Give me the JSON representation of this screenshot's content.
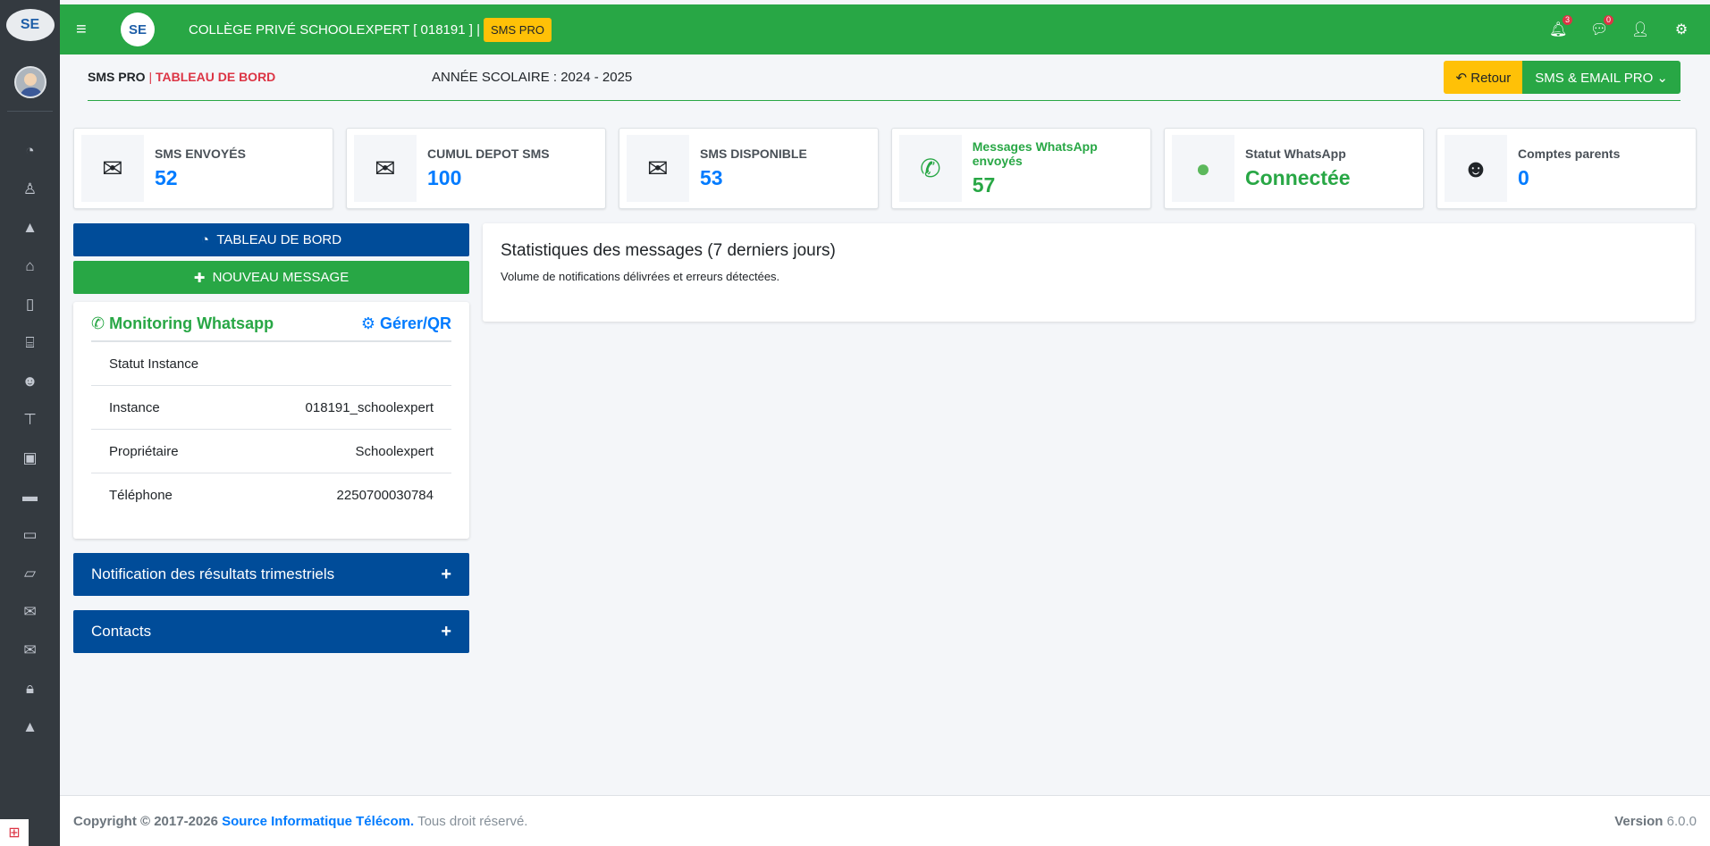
{
  "sidebar": {
    "logo_text": "SE",
    "icons": [
      "dashboard-icon",
      "child-icon",
      "graduation-icon",
      "home-icon",
      "building-icon",
      "bank-icon",
      "users-icon",
      "sitemap-icon",
      "money-icon",
      "folder-icon",
      "bus-icon",
      "folder-open-icon",
      "envelope-icon",
      "envelope-icon",
      "lock-icon",
      "graduation-icon"
    ]
  },
  "topbar": {
    "logo_text": "SE",
    "title": "COLLÈGE PRIVÉ SCHOOLEXPERT [ 018191 ] |",
    "badge": "SMS PRO",
    "notif_count": "3",
    "msg_count": "0"
  },
  "header": {
    "crumb_main": "SMS PRO",
    "crumb_sep": "|",
    "crumb_page": "TABLEAU DE BORD",
    "year": "ANNÉE SCOLAIRE : 2024 - 2025",
    "retour_label": "Retour",
    "sms_email_label": "SMS & EMAIL PRO"
  },
  "cards": [
    {
      "icon": "envelope-outline-icon",
      "label": "SMS ENVOYÉS",
      "value": "52"
    },
    {
      "icon": "envelope-outline-icon",
      "label": "CUMUL DEPOT SMS",
      "value": "100"
    },
    {
      "icon": "envelope-icon",
      "label": "SMS DISPONIBLE",
      "value": "53"
    },
    {
      "icon": "whatsapp-icon",
      "label": "Messages WhatsApp envoyés",
      "value": "57"
    },
    {
      "icon": "green-dot-icon",
      "label": "Statut WhatsApp",
      "value": "Connectée"
    },
    {
      "icon": "users-icon",
      "label": "Comptes parents",
      "value": "0"
    }
  ],
  "left": {
    "dashboard_btn": "TABLEAU DE BORD",
    "new_msg_btn": "NOUVEAU MESSAGE",
    "monitoring_title": "Monitoring Whatsapp",
    "manage_link": "Gérer/QR",
    "rows": [
      {
        "label": "Statut Instance",
        "value": ""
      },
      {
        "label": "Instance",
        "value": "018191_schoolexpert"
      },
      {
        "label": "Propriétaire",
        "value": "Schoolexpert"
      },
      {
        "label": "Téléphone",
        "value": "2250700030784"
      }
    ],
    "notif_panel": "Notification des résultats trimestriels",
    "contacts_panel": "Contacts",
    "plus": "+"
  },
  "stats": {
    "title": "Statistiques des messages (7 derniers jours)",
    "subtitle": "Volume de notifications délivrées et erreurs détectées."
  },
  "footer": {
    "copyright": "Copyright © 2017-2026",
    "brand": "Source Informatique Télécom.",
    "rights": "Tous droit réservé.",
    "version_label": "Version",
    "version": "6.0.0"
  }
}
